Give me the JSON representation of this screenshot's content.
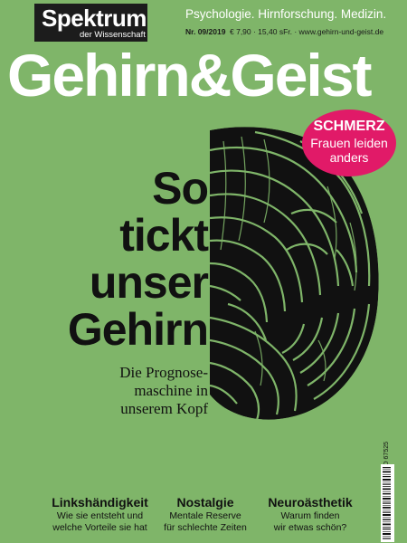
{
  "publisher": {
    "name": "Spektrum",
    "sub": "der Wissenschaft"
  },
  "tagline": "Psychologie. Hirnforschung. Medizin.",
  "issue": "Nr. 09/2019",
  "price_url": "€ 7,90 · 15,40 sFr. · www.gehirn-und-geist.de",
  "masthead": "Gehirn&Geist",
  "badge": {
    "keyword": "SCHMERZ",
    "text": "Frauen leiden anders"
  },
  "headline": "So\ntickt\nunser\nGehirn",
  "subheadline": "Die Prognose-\nmaschine in\nunserem Kopf",
  "teasers": [
    {
      "title": "Linkshändigkeit",
      "text": "Wie sie entsteht und\nwelche Vorteile sie hat"
    },
    {
      "title": "Nostalgie",
      "text": "Mentale Reserve\nfür schlechte Zeiten"
    },
    {
      "title": "Neuroästhetik",
      "text": "Warum finden\nwir etwas schön?"
    }
  ],
  "barcode_code": "D 67525",
  "colors": {
    "background": "#7fb569",
    "badge": "#e11a68",
    "masthead": "#ffffff",
    "dark": "#1c1c1c"
  },
  "image": {
    "subject": "brain-hemisphere-contour-illustration"
  }
}
